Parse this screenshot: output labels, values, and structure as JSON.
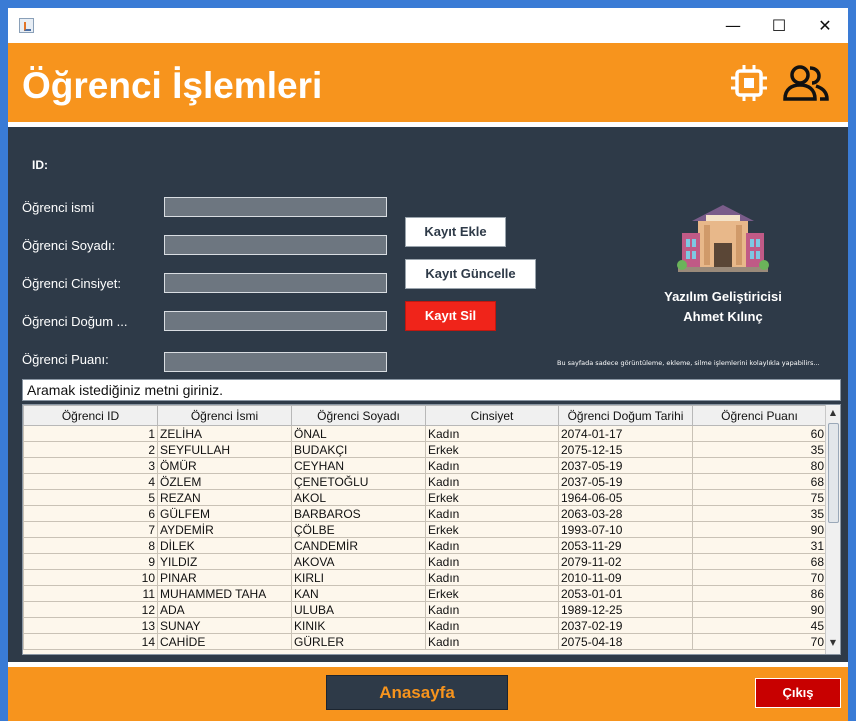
{
  "window": {
    "minimize_glyph": "—",
    "maximize_glyph": "☐",
    "close_glyph": "✕"
  },
  "header": {
    "title": "Öğrenci İşlemleri",
    "icons": [
      "chip-icon",
      "users-icon"
    ],
    "bg_color": "#f7941d"
  },
  "form": {
    "id_label": "ID:",
    "fields": [
      {
        "label": "Öğrenci ismi",
        "value": ""
      },
      {
        "label": "Öğrenci Soyadı:",
        "value": ""
      },
      {
        "label": "Öğrenci Cinsiyet:",
        "value": ""
      },
      {
        "label": "Öğrenci Doğum ...",
        "value": ""
      },
      {
        "label": "Öğrenci Puanı:",
        "value": ""
      }
    ]
  },
  "actions": {
    "add_label": "Kayıt Ekle",
    "update_label": "Kayıt Güncelle",
    "delete_label": "Kayıt Sil"
  },
  "developer": {
    "line1": "Yazılım Geliştiricisi",
    "line2": "Ahmet Kılınç",
    "image_icon": "library-building-icon",
    "note": "Bu sayfada sadece görüntüleme, ekleme, silme işlemlerini kolaylıkla yapabilirs..."
  },
  "search": {
    "value": "Aramak istediğiniz metni giriniz."
  },
  "table": {
    "columns": [
      "Öğrenci ID",
      "Öğrenci İsmi",
      "Öğrenci Soyadı",
      "Cinsiyet",
      "Öğrenci Doğum Tarihi",
      "Öğrenci Puanı"
    ],
    "rows": [
      [
        "1",
        "ZELİHA",
        "ÖNAL",
        "Kadın",
        "2074-01-17",
        "60"
      ],
      [
        "2",
        "SEYFULLAH",
        "BUDAKÇI",
        "Erkek",
        "2075-12-15",
        "35"
      ],
      [
        "3",
        "ÖMÜR",
        "CEYHAN",
        "Kadın",
        "2037-05-19",
        "80"
      ],
      [
        "4",
        "ÖZLEM",
        "ÇENETOĞLU",
        "Kadın",
        "2037-05-19",
        "68"
      ],
      [
        "5",
        "REZAN",
        "AKOL",
        "Erkek",
        "1964-06-05",
        "75"
      ],
      [
        "6",
        "GÜLFEM",
        "BARBAROS",
        "Kadın",
        "2063-03-28",
        "35"
      ],
      [
        "7",
        "AYDEMİR",
        "ÇÖLBE",
        "Erkek",
        "1993-07-10",
        "90"
      ],
      [
        "8",
        "DİLEK",
        "CANDEMİR",
        "Kadın",
        "2053-11-29",
        "31"
      ],
      [
        "9",
        "YILDIZ",
        "AKOVA",
        "Kadın",
        "2079-11-02",
        "68"
      ],
      [
        "10",
        "PINAR",
        "KIRLI",
        "Kadın",
        "2010-11-09",
        "70"
      ],
      [
        "11",
        "MUHAMMED TAHA",
        "KAN",
        "Erkek",
        "2053-01-01",
        "86"
      ],
      [
        "12",
        "ADA",
        "ULUBA",
        "Kadın",
        "1989-12-25",
        "90"
      ],
      [
        "13",
        "SUNAY",
        "KINIK",
        "Kadın",
        "2037-02-19",
        "45"
      ],
      [
        "14",
        "CAHİDE",
        "GÜRLER",
        "Kadın",
        "2075-04-18",
        "70"
      ]
    ]
  },
  "footer": {
    "home_label": "Anasayfa",
    "exit_label": "Çıkış"
  }
}
